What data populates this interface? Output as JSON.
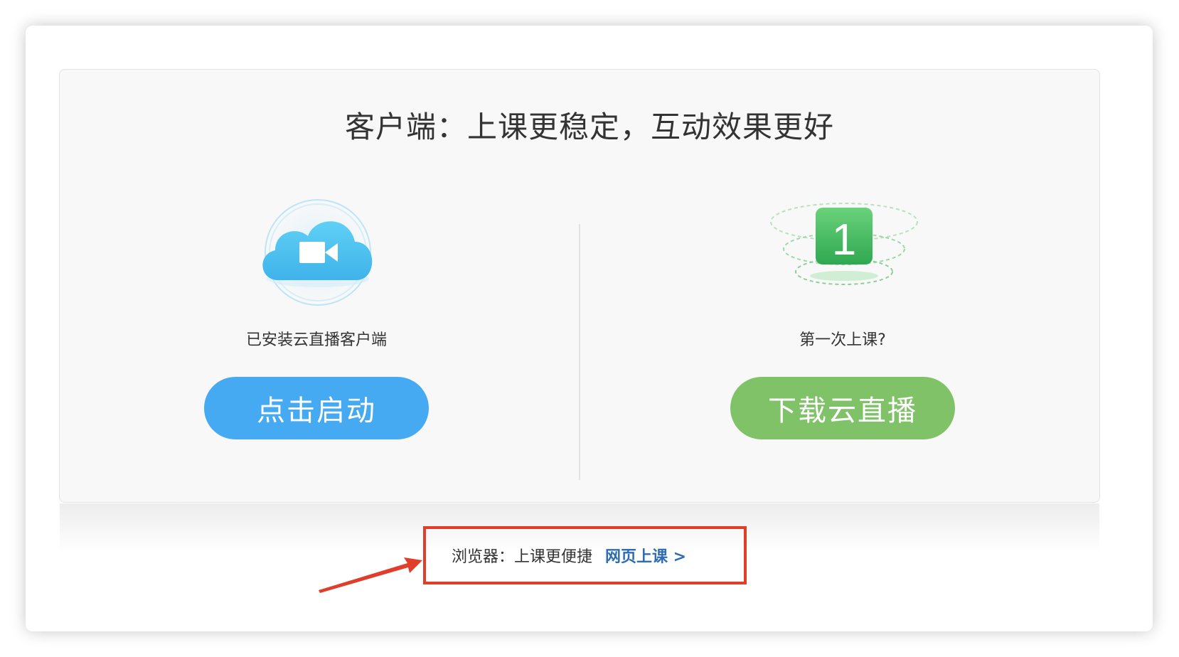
{
  "title": "客户端：上课更稳定，互动效果更好",
  "left": {
    "icon": "cloud-video-icon",
    "caption": "已安装云直播客户端",
    "button": "点击启动",
    "button_color": "#45aaf2"
  },
  "right": {
    "icon": "number-one-icon",
    "icon_text": "1",
    "caption": "第一次上课?",
    "button": "下载云直播",
    "button_color": "#80c268"
  },
  "browser": {
    "label": "浏览器：上课更便捷",
    "link": "网页上课 >"
  },
  "annotation": {
    "icon": "red-arrow-icon",
    "highlight_color": "#e03d2a"
  }
}
